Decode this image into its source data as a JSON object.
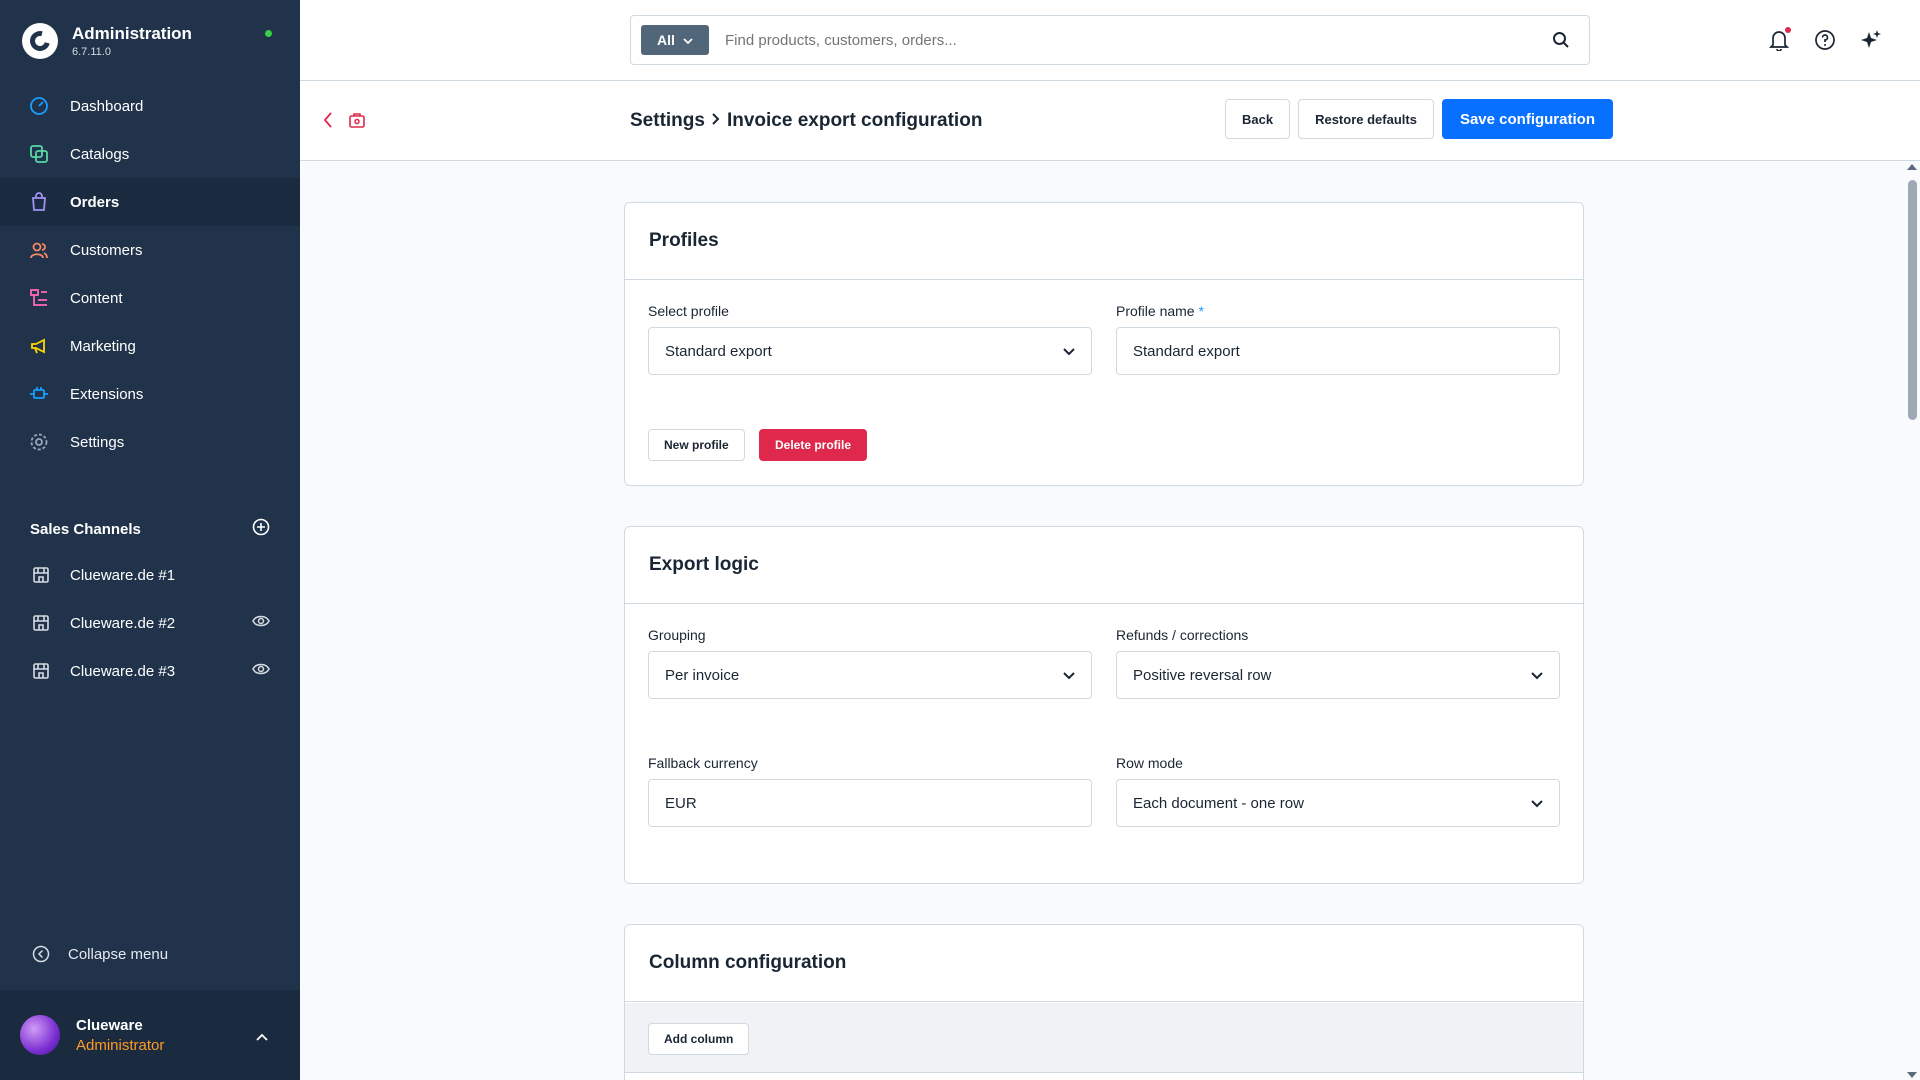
{
  "sidebar": {
    "app_title": "Administration",
    "version": "6.7.11.0",
    "nav": [
      {
        "label": "Dashboard",
        "icon": "dashboard-icon"
      },
      {
        "label": "Catalogs",
        "icon": "catalogs-icon"
      },
      {
        "label": "Orders",
        "icon": "orders-icon",
        "active": true
      },
      {
        "label": "Customers",
        "icon": "customers-icon"
      },
      {
        "label": "Content",
        "icon": "content-icon"
      },
      {
        "label": "Marketing",
        "icon": "marketing-icon"
      },
      {
        "label": "Extensions",
        "icon": "extensions-icon"
      },
      {
        "label": "Settings",
        "icon": "settings-icon"
      }
    ],
    "sales_channels_title": "Sales Channels",
    "sales_channels": [
      {
        "label": "Clueware.de #1"
      },
      {
        "label": "Clueware.de #2"
      },
      {
        "label": "Clueware.de #3"
      }
    ],
    "collapse_label": "Collapse menu",
    "user": {
      "name": "Clueware",
      "role": "Administrator"
    }
  },
  "topbar": {
    "search_scope": "All",
    "search_placeholder": "Find products, customers, orders..."
  },
  "smartbar": {
    "breadcrumb_parent": "Settings",
    "breadcrumb_current": "Invoice export configuration",
    "back_label": "Back",
    "restore_label": "Restore defaults",
    "save_label": "Save configuration"
  },
  "profiles": {
    "title": "Profiles",
    "select_label": "Select profile",
    "select_value": "Standard export",
    "name_label": "Profile name",
    "name_required": "*",
    "name_value": "Standard export",
    "new_label": "New profile",
    "delete_label": "Delete profile"
  },
  "export_logic": {
    "title": "Export logic",
    "grouping_label": "Grouping",
    "grouping_value": "Per invoice",
    "refunds_label": "Refunds / corrections",
    "refunds_value": "Positive reversal row",
    "currency_label": "Fallback currency",
    "currency_value": "EUR",
    "rowmode_label": "Row mode",
    "rowmode_value": "Each document - one row"
  },
  "columns": {
    "title": "Column configuration",
    "add_label": "Add column"
  },
  "colors": {
    "sidebar_bg": "#21334a",
    "primary": "#0870ff",
    "danger": "#de294c",
    "role": "#ff9a24"
  }
}
